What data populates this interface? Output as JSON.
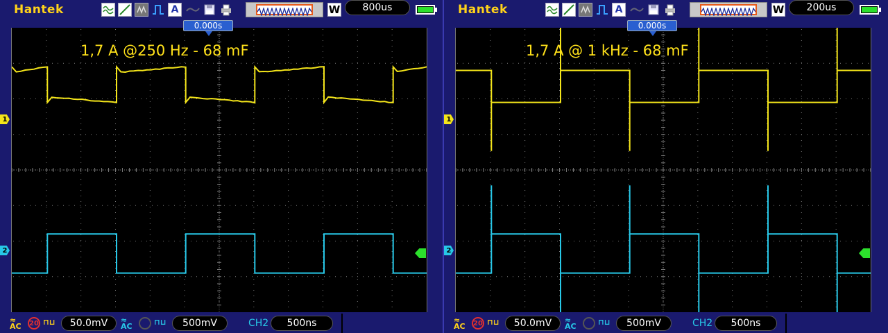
{
  "panels": [
    {
      "brand": "Hantek",
      "timebase": "800us",
      "trigger_position": "0.000s",
      "annotation": "1,7 A @250 Hz - 68 mF",
      "ch1_marker": "1",
      "ch2_marker": "2",
      "ch1_coupling": "AC",
      "ch1_bw_limit": "20",
      "ch1_scale": "50.0mV",
      "ch2_coupling": "AC",
      "ch2_scale": "500mV",
      "trigger_source": "CH2",
      "trigger_time": "500ns",
      "ch1_trace": {
        "period_div": 4,
        "high_div": 2.9,
        "low_div": 1.9,
        "edge_div": 1.0
      },
      "ch2_trace": {
        "period_div": 4,
        "high_div": -1.8,
        "low_div": -2.9,
        "edge_div": 1.0
      }
    },
    {
      "brand": "Hantek",
      "timebase": "200us",
      "trigger_position": "0.000s",
      "annotation": "1,7 A @ 1 kHz - 68 mF",
      "ch1_marker": "1",
      "ch2_marker": "2",
      "ch1_coupling": "AC",
      "ch1_bw_limit": "20",
      "ch1_scale": "50.0mV",
      "ch2_coupling": "AC",
      "ch2_scale": "500mV",
      "trigger_source": "CH2",
      "trigger_time": "500ns",
      "ch1_trace": {
        "period_div": 4,
        "high_div": 2.8,
        "low_div": 1.9,
        "edge_div": 1.0
      },
      "ch2_trace": {
        "period_div": 4,
        "high_div": -1.8,
        "low_div": -2.9,
        "edge_div": 1.0
      }
    }
  ],
  "colors": {
    "ch1": "#f4e51a",
    "ch2": "#27c8e8",
    "brand": "#ffd21a",
    "trigger": "#2ce02c",
    "grid": "#7a7a7a"
  },
  "icons": [
    "mode-icon",
    "line-icon",
    "persist-icon",
    "pulse-icon",
    "auto-icon",
    "link-icon",
    "save-icon",
    "print-icon",
    "memory-window-icon",
    "battery-icon"
  ]
}
